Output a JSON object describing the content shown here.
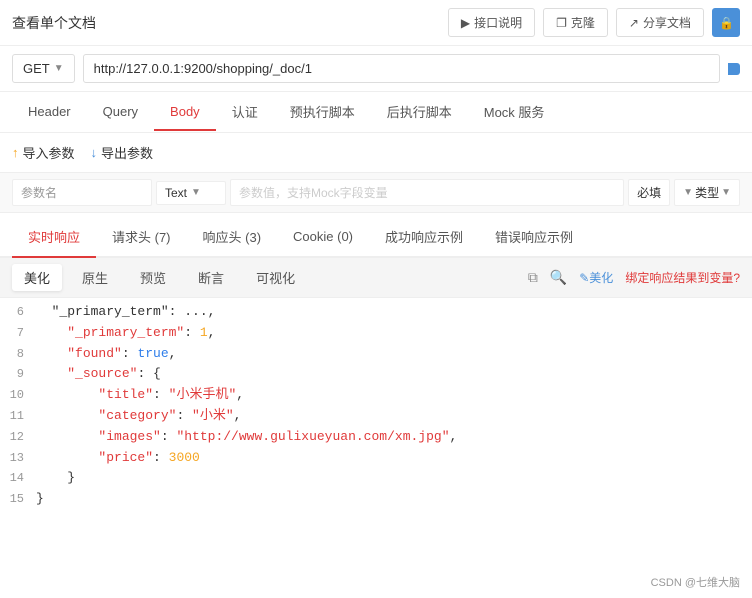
{
  "topbar": {
    "title": "查看单个文档",
    "buttons": [
      {
        "label": "接口说明",
        "icon": "▶"
      },
      {
        "label": "克隆",
        "icon": "❐"
      },
      {
        "label": "分享文档",
        "icon": "↗"
      },
      {
        "label": "",
        "icon": "🔒"
      }
    ]
  },
  "urlbar": {
    "method": "GET",
    "url": "http://127.0.0.1:9200/shopping/_doc/1"
  },
  "tabs": [
    {
      "label": "Header"
    },
    {
      "label": "Query"
    },
    {
      "label": "Body",
      "active": true
    },
    {
      "label": "认证"
    },
    {
      "label": "预执行脚本"
    },
    {
      "label": "后执行脚本"
    },
    {
      "label": "Mock 服务"
    }
  ],
  "params": {
    "import_label": "导入参数",
    "export_label": "导出参数",
    "columns": {
      "name_placeholder": "参数名",
      "type_label": "Text",
      "value_placeholder": "参数值，支持Mock字段变量",
      "required_label": "必填",
      "types_label": "类型"
    }
  },
  "response_tabs": [
    {
      "label": "实时响应",
      "active": true
    },
    {
      "label": "请求头 (7)"
    },
    {
      "label": "响应头 (3)"
    },
    {
      "label": "Cookie (0)"
    },
    {
      "label": "成功响应示例"
    },
    {
      "label": "错误响应示例"
    }
  ],
  "view_tabs": [
    {
      "label": "美化",
      "active": true
    },
    {
      "label": "原生"
    },
    {
      "label": "预览"
    },
    {
      "label": "断言"
    },
    {
      "label": "可视化"
    }
  ],
  "view_actions": {
    "copy_icon": "⧉",
    "search_icon": "🔍",
    "beautify_label": "✎美化",
    "bind_label": "绑定响应结果到变量?"
  },
  "code_lines": [
    {
      "num": "6",
      "content": [
        {
          "text": "  \"_primary_term\": ",
          "class": "c-key"
        },
        {
          "text": " ...",
          "class": "c-punc"
        }
      ]
    },
    {
      "num": "7",
      "raw": "    \"_primary_term\": 1,"
    },
    {
      "num": "8",
      "raw": "    \"found\": true,"
    },
    {
      "num": "9",
      "raw": "    \"_source\": {"
    },
    {
      "num": "10",
      "raw": "        \"title\": \"小米手机\","
    },
    {
      "num": "11",
      "raw": "        \"category\": \"小米\","
    },
    {
      "num": "12",
      "raw": "        \"images\": \"http://www.gulixueyuan.com/xm.jpg\","
    },
    {
      "num": "13",
      "raw": "        \"price\": 3000"
    },
    {
      "num": "14",
      "raw": "    }"
    },
    {
      "num": "15",
      "raw": "}"
    }
  ],
  "watermark": "CSDN @七维大脑"
}
